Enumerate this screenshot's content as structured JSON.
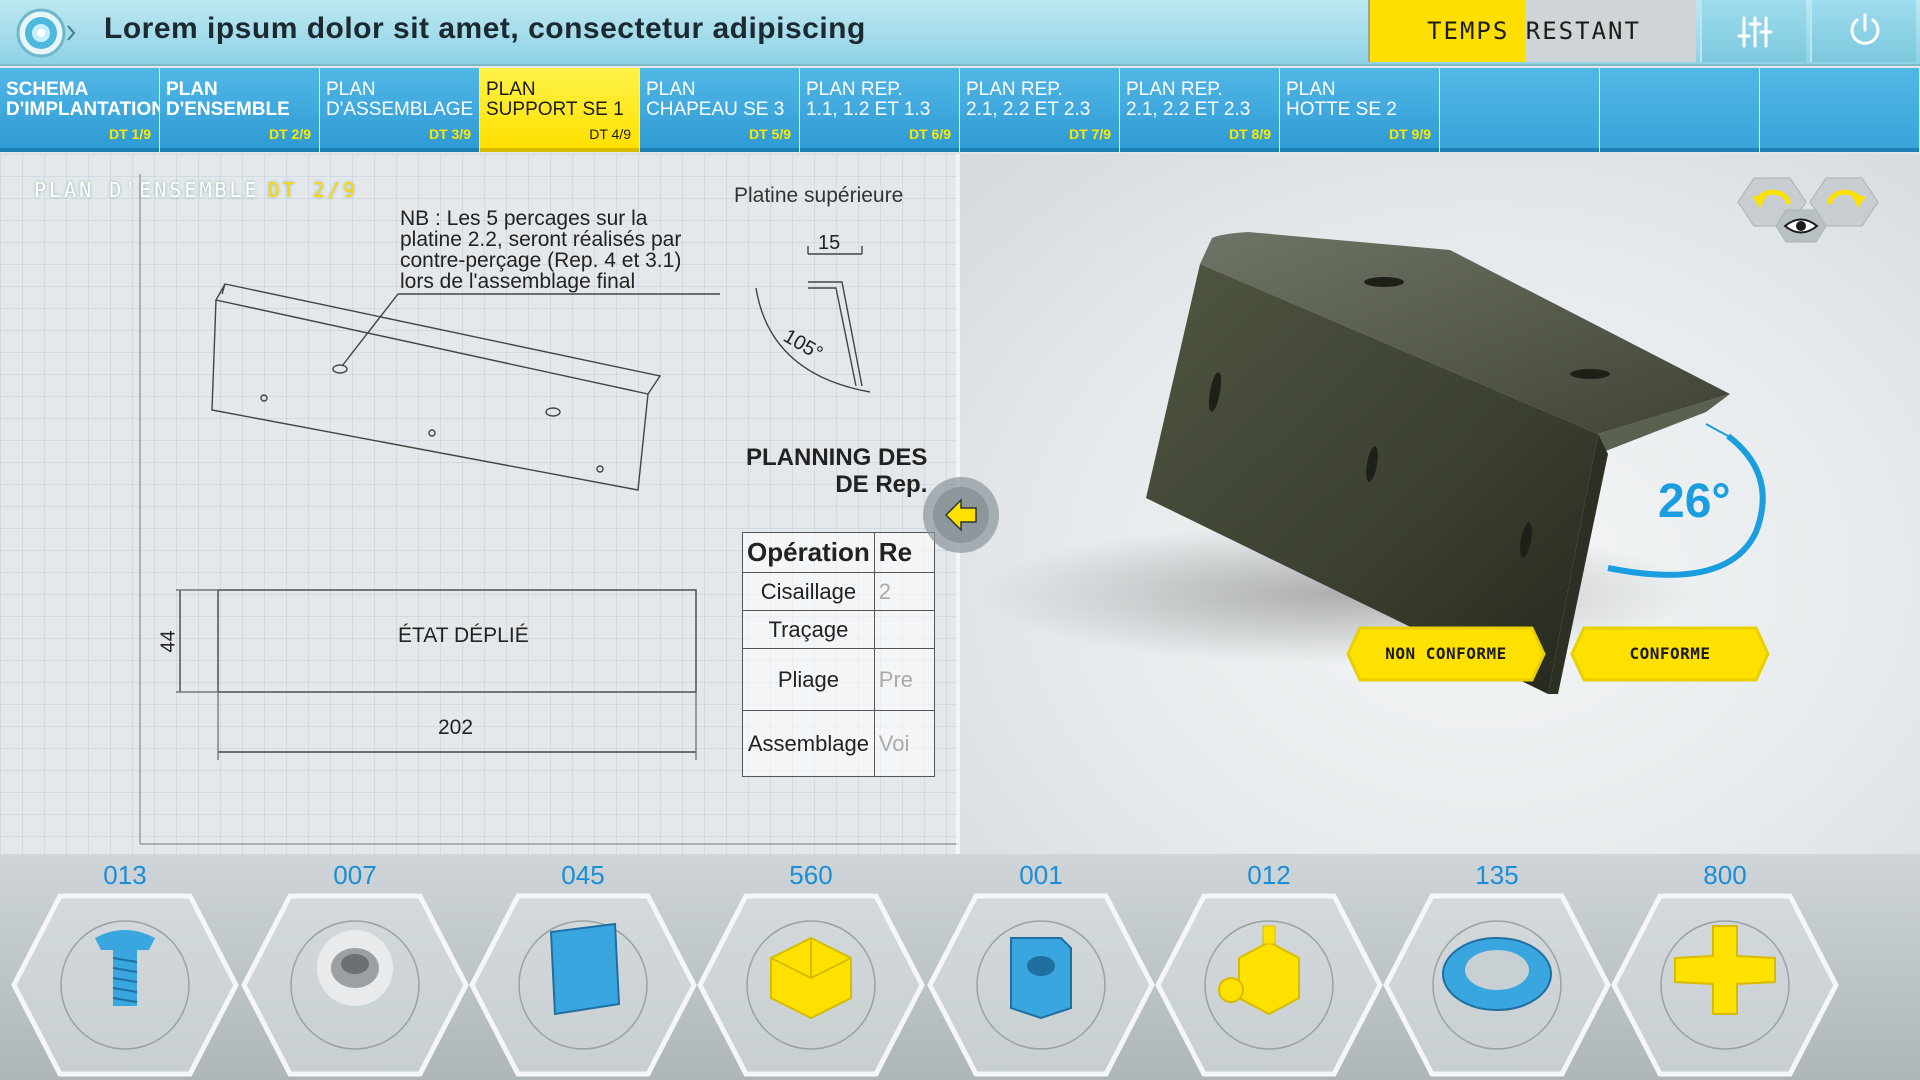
{
  "header": {
    "title": "Lorem ipsum dolor sit amet, consectetur adipiscing",
    "timer_label": "TEMPS RESTANT",
    "icons": [
      "logo-icon",
      "settings-sliders-icon",
      "power-icon"
    ]
  },
  "tabs": [
    {
      "label": "SCHEMA\nD'IMPLANTATION",
      "dt": "DT 1/9",
      "bold": true
    },
    {
      "label": "PLAN\nD'ENSEMBLE",
      "dt": "DT 2/9",
      "bold": true
    },
    {
      "label": "PLAN\nD'ASSEMBLAGE",
      "dt": "DT 3/9"
    },
    {
      "label": "PLAN\nSUPPORT SE 1",
      "dt": "DT 4/9",
      "active": true
    },
    {
      "label": "PLAN\nCHAPEAU SE 3",
      "dt": "DT 5/9"
    },
    {
      "label": "PLAN REP.\n1.1, 1.2 ET 1.3",
      "dt": "DT 6/9"
    },
    {
      "label": "PLAN REP.\n2.1, 2.2 ET 2.3",
      "dt": "DT 7/9"
    },
    {
      "label": "PLAN REP.\n2.1, 2.2 ET 2.3",
      "dt": "DT 8/9"
    },
    {
      "label": "PLAN\nHOTTE SE 2",
      "dt": "DT 9/9"
    },
    {
      "label": "",
      "dt": ""
    },
    {
      "label": "",
      "dt": ""
    },
    {
      "label": "",
      "dt": ""
    }
  ],
  "drawing": {
    "title": "PLAN D'ENSEMBLE",
    "title_dt": "DT 2/9",
    "note": "NB : Les 5 percages sur la\nplatine 2.2,  seront réalisés par\ncontre-perçage (Rep. 4 et 3.1)\nlors de l'assemblage final",
    "platine_label": "Platine supérieure",
    "dim_15": "15",
    "dim_105": "105°",
    "unfolded_label": "ÉTAT DÉPLIÉ",
    "dim_44": "44",
    "dim_202": "202",
    "planning_title": "PLANNING DES\nDE Rep.",
    "table": {
      "header": [
        "Opération",
        "Re"
      ],
      "rows": [
        [
          "Cisaillage",
          "2"
        ],
        [
          "Traçage",
          ""
        ],
        [
          "Pliage",
          "Pre"
        ],
        [
          "Assemblage",
          "Voi"
        ]
      ]
    }
  },
  "viewer": {
    "angle": "26°",
    "btn_non_conforme": "NON CONFORME",
    "btn_conforme": "CONFORME",
    "icons": [
      "rotate-left-icon",
      "eye-icon",
      "rotate-right-icon",
      "swap-arrows-icon"
    ]
  },
  "parts": [
    {
      "num": "013",
      "icon": "screw-icon",
      "color": "#3aa6e0"
    },
    {
      "num": "007",
      "icon": "pipe-connector-icon",
      "color": "#9aa0a3"
    },
    {
      "num": "045",
      "icon": "plate-icon",
      "color": "#3aa6e0"
    },
    {
      "num": "560",
      "icon": "block-icon",
      "color": "#ffe100"
    },
    {
      "num": "001",
      "icon": "bracket-icon",
      "color": "#3aa6e0"
    },
    {
      "num": "012",
      "icon": "junction-box-icon",
      "color": "#ffe100"
    },
    {
      "num": "135",
      "icon": "ring-flange-icon",
      "color": "#3aa6e0"
    },
    {
      "num": "800",
      "icon": "cross-fitting-icon",
      "color": "#ffe100"
    }
  ],
  "colors": {
    "accent_blue": "#2f9bd4",
    "accent_yellow": "#ffe100",
    "header_cyan": "#8fd2e6"
  }
}
